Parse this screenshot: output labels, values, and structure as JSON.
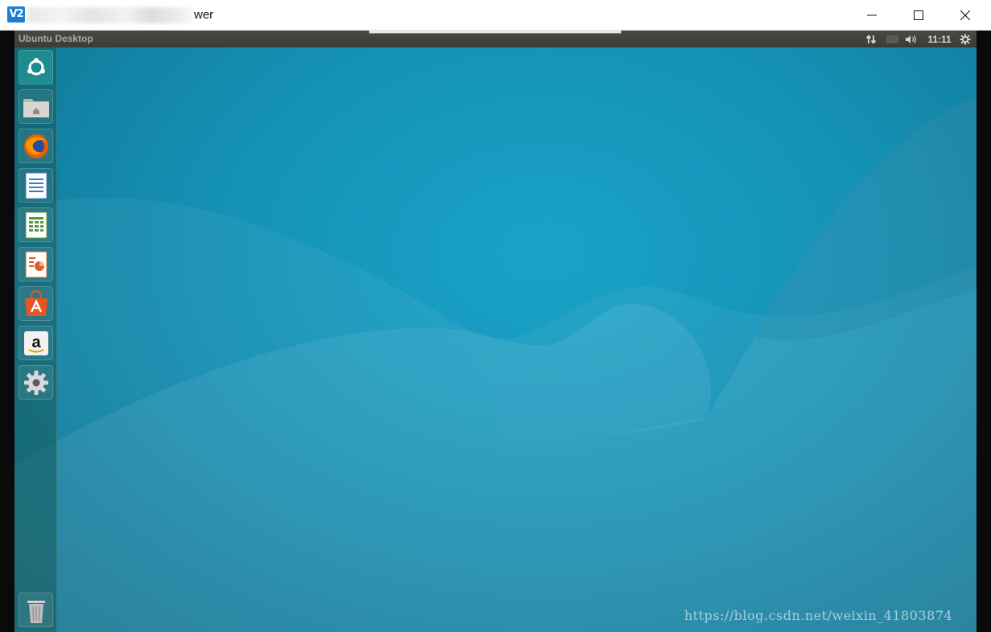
{
  "window": {
    "app_icon_text": "V2",
    "title_suffix": "wer",
    "controls": {
      "minimize": "minimize",
      "maximize": "maximize",
      "close": "close"
    }
  },
  "panel": {
    "title": "Ubuntu Desktop",
    "clock": "11:11"
  },
  "launcher": {
    "items": [
      {
        "name": "Search your computer",
        "icon": "ubuntu-dash-icon"
      },
      {
        "name": "Files",
        "icon": "home-folder-icon"
      },
      {
        "name": "Firefox Web Browser",
        "icon": "firefox-icon"
      },
      {
        "name": "LibreOffice Writer",
        "icon": "writer-icon"
      },
      {
        "name": "LibreOffice Calc",
        "icon": "calc-icon"
      },
      {
        "name": "LibreOffice Impress",
        "icon": "impress-icon"
      },
      {
        "name": "Ubuntu Software",
        "icon": "software-center-icon"
      },
      {
        "name": "Amazon",
        "icon": "amazon-icon"
      },
      {
        "name": "System Settings",
        "icon": "settings-gear-icon"
      },
      {
        "name": "Trash",
        "icon": "trash-icon"
      }
    ]
  },
  "watermark": "https://blog.csdn.net/weixin_41803874",
  "colors": {
    "panel": "#3c3b37",
    "desktop": "#1590b5",
    "accent": "#1a7fd4"
  }
}
